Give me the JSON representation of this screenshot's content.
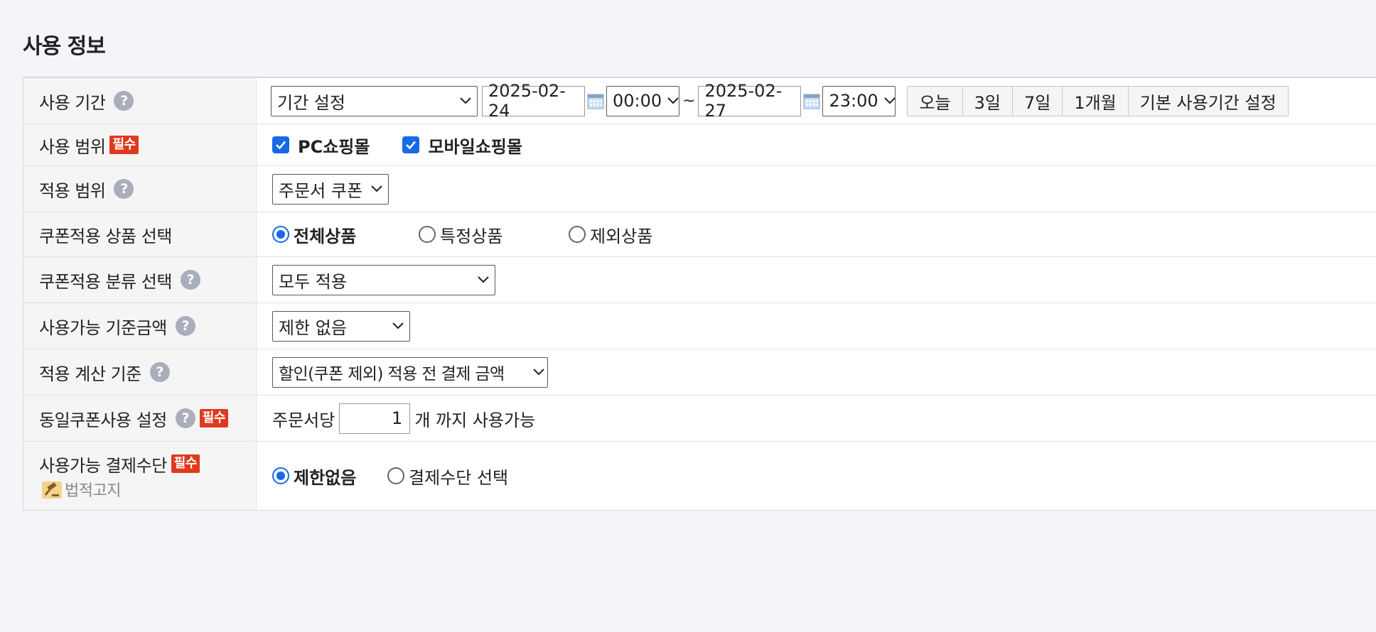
{
  "section_title": "사용 정보",
  "rows": {
    "period": {
      "label": "사용 기간",
      "mode_select": "기간 설정",
      "start_date": "2025-02-24",
      "start_time": "00:00",
      "separator": "~",
      "end_date": "2025-02-27",
      "end_time": "23:00",
      "quick_buttons": [
        "오늘",
        "3일",
        "7일",
        "1개월",
        "기본 사용기간 설정"
      ]
    },
    "scope": {
      "label": "사용 범위",
      "required": "필수",
      "options": [
        {
          "label": "PC쇼핑몰",
          "checked": true
        },
        {
          "label": "모바일쇼핑몰",
          "checked": true
        }
      ]
    },
    "apply_scope": {
      "label": "적용 범위",
      "select": "주문서 쿠폰"
    },
    "product_select": {
      "label": "쿠폰적용 상품 선택",
      "options": [
        {
          "label": "전체상품",
          "selected": true
        },
        {
          "label": "특정상품",
          "selected": false
        },
        {
          "label": "제외상품",
          "selected": false
        }
      ]
    },
    "category_select": {
      "label": "쿠폰적용 분류 선택",
      "select": "모두 적용"
    },
    "min_amount": {
      "label": "사용가능 기준금액",
      "select": "제한 없음"
    },
    "calc_basis": {
      "label": "적용 계산 기준",
      "select": "할인(쿠폰 제외) 적용 전 결제 금액"
    },
    "same_coupon": {
      "label": "동일쿠폰사용 설정",
      "required": "필수",
      "prefix": "주문서당",
      "value": "1",
      "suffix": "개 까지 사용가능"
    },
    "payment": {
      "label": "사용가능 결제수단",
      "required": "필수",
      "legal_notice": "법적고지",
      "options": [
        {
          "label": "제한없음",
          "selected": true
        },
        {
          "label": "결제수단 선택",
          "selected": false
        }
      ]
    }
  },
  "colors": {
    "accent": "#1769e8",
    "required_badge": "#e0391e",
    "help_icon": "#a9adbc",
    "label_bg": "#f5f5f6"
  }
}
